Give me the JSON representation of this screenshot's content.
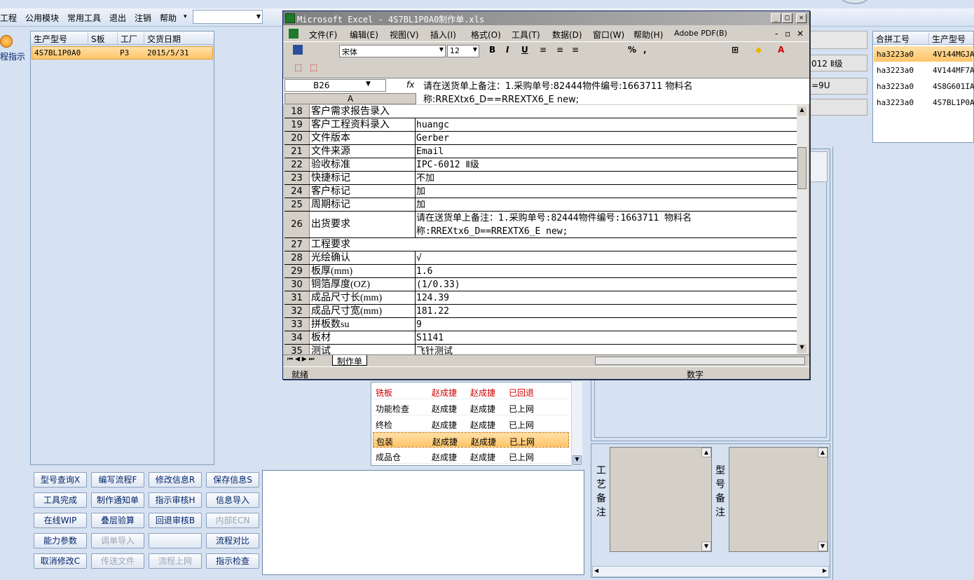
{
  "menubar": {
    "items": [
      "工程",
      "公用模块",
      "常用工具",
      "退出",
      "注销",
      "帮助"
    ],
    "help_arrow": "▾"
  },
  "side": {
    "label": "程指示"
  },
  "left_table": {
    "headers": [
      "生产型号",
      "S板",
      "工厂",
      "交货日期"
    ],
    "rows": [
      [
        "4S7BL1P0A0",
        "",
        "P3",
        "2015/5/31"
      ]
    ]
  },
  "process_list": {
    "rows": [
      {
        "step": "铣板",
        "a": "赵成捷",
        "b": "赵成捷",
        "status": "已回退",
        "red": true,
        "selected": false
      },
      {
        "step": "功能检查",
        "a": "赵成捷",
        "b": "赵成捷",
        "status": "已上网",
        "red": false,
        "selected": false
      },
      {
        "step": "终检",
        "a": "赵成捷",
        "b": "赵成捷",
        "status": "已上网",
        "red": false,
        "selected": false
      },
      {
        "step": "包装",
        "a": "赵成捷",
        "b": "赵成捷",
        "status": "已上网",
        "red": false,
        "selected": true
      },
      {
        "step": "成品仓",
        "a": "赵成捷",
        "b": "赵成捷",
        "status": "已上网",
        "red": false,
        "selected": false
      }
    ]
  },
  "buttons": [
    [
      "型号查询X",
      "编写流程F",
      "修改信息R",
      "保存信息S"
    ],
    [
      "工具完成",
      "制作通知单",
      "指示审核H",
      "信息导入"
    ],
    [
      "在线WIP",
      "叠层验算",
      "回退审核B",
      "内部ECN"
    ],
    [
      "能力参数",
      "调单导入",
      "",
      "流程对比"
    ],
    [
      "取消修改C",
      "传送文件",
      "流程上网",
      "指示检查"
    ]
  ],
  "disabled_buttons": [
    "内部ECN",
    "调单导入",
    "传送文件",
    "流程上网"
  ],
  "right_boxes": {
    "b1": "",
    "b2": "012 Ⅱ级",
    "b3": "=9U",
    "b4": ""
  },
  "right_table": {
    "headers": [
      "合拼工号",
      "生产型号"
    ],
    "rows": [
      [
        "ha3223a0",
        "4V144MGJA"
      ],
      [
        "ha3223a0",
        "4V144MF7A"
      ],
      [
        "ha3223a0",
        "4S8G601IA"
      ],
      [
        "ha3223a0",
        "4S7BL1P0A"
      ]
    ]
  },
  "memo": {
    "label1": [
      "工",
      "艺",
      "备",
      "注"
    ],
    "label2": [
      "型",
      "号",
      "备",
      "注"
    ]
  },
  "excel": {
    "title": "Microsoft Excel - 4S7BL1P0A0制作单.xls",
    "menu": [
      "文件(F)",
      "编辑(E)",
      "视图(V)",
      "插入(I)",
      "格式(O)",
      "工具(T)",
      "数据(D)",
      "窗口(W)",
      "帮助(H)",
      "Adobe PDF(B)"
    ],
    "font": "宋体",
    "size": "12",
    "namebox": "B26",
    "fx": "fx",
    "formula": "请在送货单上备注：1.采购单号:82444物件编号:1663711 物料名称:RREXtx6_D==RREXTX6_E new;",
    "col_header": "A",
    "rows": [
      {
        "n": "18",
        "a": "客户需求报告录入",
        "b": ""
      },
      {
        "n": "19",
        "a": "客户工程资料录入",
        "b": "huangc"
      },
      {
        "n": "20",
        "a": "文件版本",
        "b": "Gerber"
      },
      {
        "n": "21",
        "a": "文件来源",
        "b": "Email"
      },
      {
        "n": "22",
        "a": "验收标准",
        "b": "IPC-6012 Ⅱ级"
      },
      {
        "n": "23",
        "a": "快捷标记",
        "b": "不加"
      },
      {
        "n": "24",
        "a": "客户标记",
        "b": "加"
      },
      {
        "n": "25",
        "a": "周期标记",
        "b": "加"
      },
      {
        "n": "26",
        "a": "出货要求",
        "b": "请在送货单上备注：1.采购单号:82444物件编号:1663711 物料名称:RREXtx6_D==RREXTX6_E new;"
      },
      {
        "n": "27",
        "a": "工程要求",
        "b": ""
      },
      {
        "n": "28",
        "a": "光绘确认",
        "b": "√"
      },
      {
        "n": "29",
        "a": "板厚(mm)",
        "b": "1.6"
      },
      {
        "n": "30",
        "a": "铜箔厚度(OZ)",
        "b": "(1/0.33)"
      },
      {
        "n": "31",
        "a": "成品尺寸长(mm)",
        "b": "124.39"
      },
      {
        "n": "32",
        "a": "成品尺寸宽(mm)",
        "b": "181.22"
      },
      {
        "n": "33",
        "a": "拼板数su",
        "b": "9"
      },
      {
        "n": "34",
        "a": "板材",
        "b": "S1141"
      },
      {
        "n": "35",
        "a": "测试",
        "b": "飞针测试"
      }
    ],
    "sheet_tab": "制作单",
    "status_left": "就绪",
    "status_num": "数字"
  }
}
